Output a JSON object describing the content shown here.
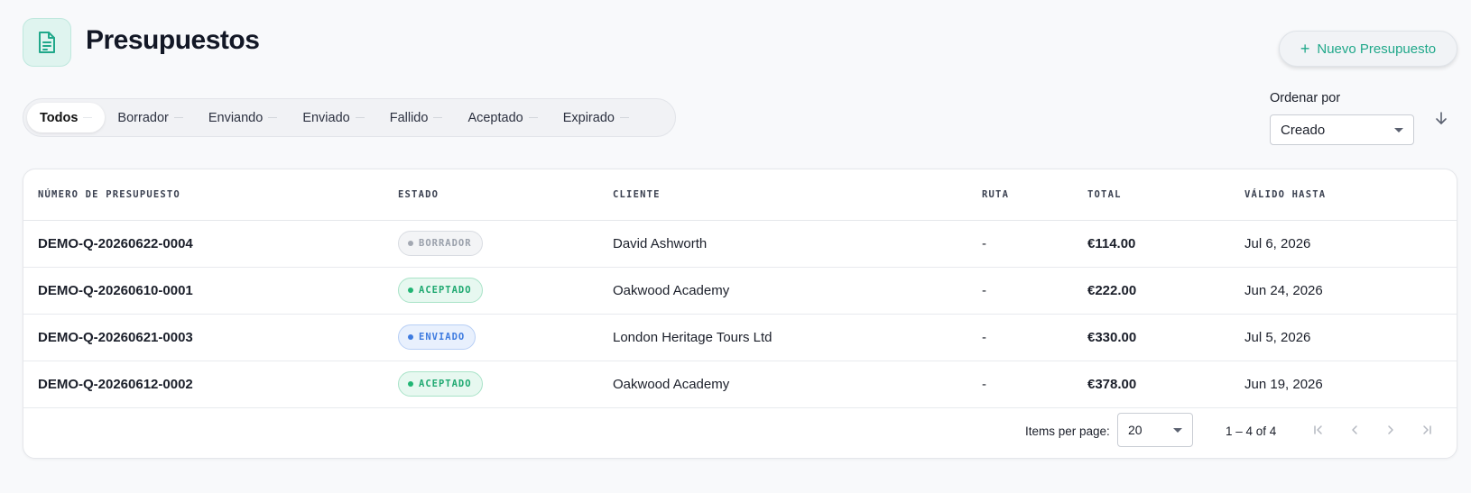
{
  "header": {
    "title": "Presupuestos",
    "icon": "document-icon",
    "new_button_label": "Nuevo Presupuesto"
  },
  "filters": [
    {
      "label": "Todos",
      "active": true
    },
    {
      "label": "Borrador",
      "active": false
    },
    {
      "label": "Enviando",
      "active": false
    },
    {
      "label": "Enviado",
      "active": false
    },
    {
      "label": "Fallido",
      "active": false
    },
    {
      "label": "Aceptado",
      "active": false
    },
    {
      "label": "Expirado",
      "active": false
    }
  ],
  "sort": {
    "label": "Ordenar por",
    "value": "Creado",
    "direction": "descending"
  },
  "table": {
    "columns": [
      "NÚMERO DE PRESUPUESTO",
      "ESTADO",
      "CLIENTE",
      "RUTA",
      "TOTAL",
      "VÁLIDO HASTA"
    ],
    "rows": [
      {
        "number": "DEMO-Q-20260622-0004",
        "status": "BORRADOR",
        "client": "David Ashworth",
        "route": "-",
        "total": "€114.00",
        "valid_until": "Jul 6, 2026"
      },
      {
        "number": "DEMO-Q-20260610-0001",
        "status": "ACEPTADO",
        "client": "Oakwood Academy",
        "route": "-",
        "total": "€222.00",
        "valid_until": "Jun 24, 2026"
      },
      {
        "number": "DEMO-Q-20260621-0003",
        "status": "ENVIADO",
        "client": "London Heritage Tours Ltd",
        "route": "-",
        "total": "€330.00",
        "valid_until": "Jul 5, 2026"
      },
      {
        "number": "DEMO-Q-20260612-0002",
        "status": "ACEPTADO",
        "client": "Oakwood Academy",
        "route": "-",
        "total": "€378.00",
        "valid_until": "Jun 19, 2026"
      }
    ]
  },
  "status_colors": {
    "BORRADOR": {
      "text": "#9aa0ab",
      "bg": "#f3f4f6",
      "border": "#d9dce2",
      "dot": "#a3a8b2"
    },
    "ACEPTADO": {
      "text": "#1fa971",
      "bg": "#e7f8f0",
      "border": "#a9e3c8",
      "dot": "#21b574"
    },
    "ENVIADO": {
      "text": "#3e7be0",
      "bg": "#e8f0fd",
      "border": "#b8cff5",
      "dot": "#3e7be0"
    }
  },
  "paginator": {
    "items_per_page_label": "Items per page:",
    "items_per_page": "20",
    "range": "1 – 4 of 4"
  },
  "colors": {
    "accent": "#20a88a",
    "background": "#f8f9fb"
  }
}
